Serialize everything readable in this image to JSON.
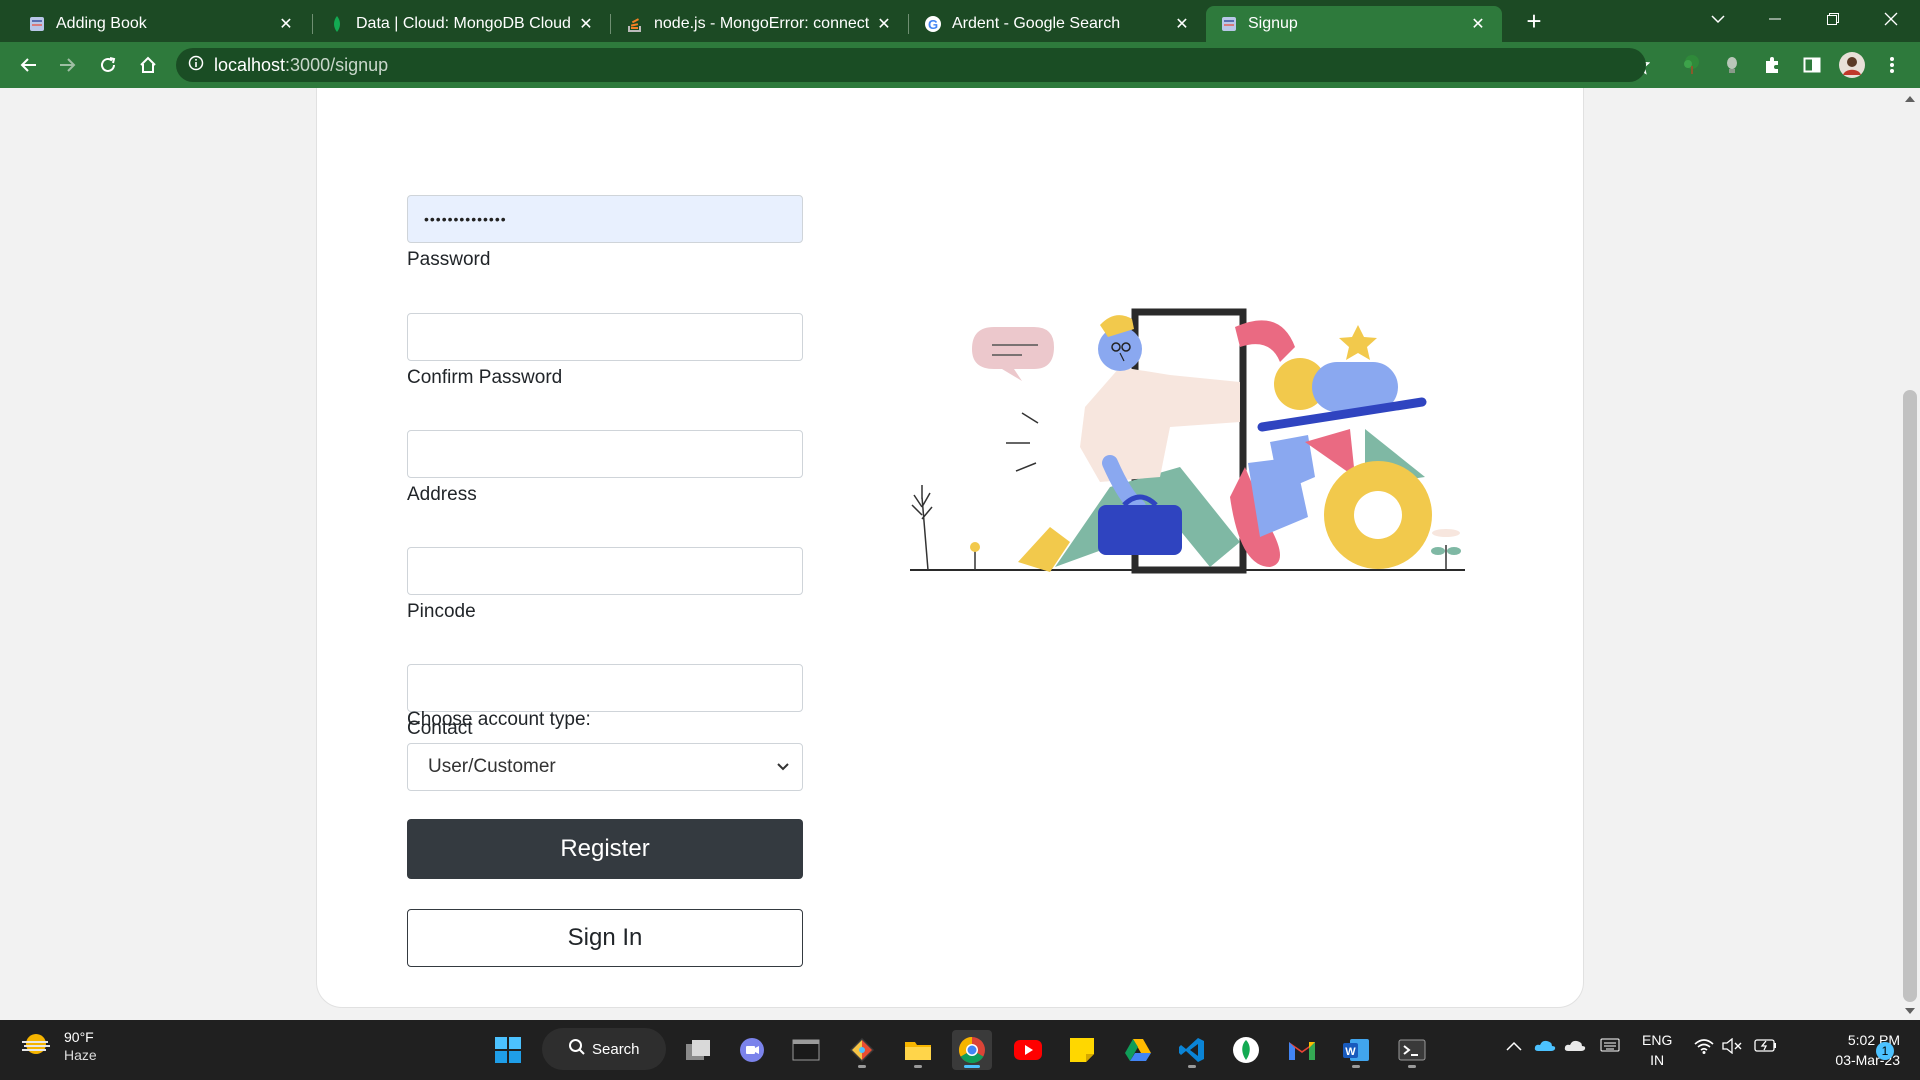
{
  "browser": {
    "tabs": [
      {
        "title": "Adding Book",
        "icon": "book-favicon",
        "active": false
      },
      {
        "title": "Data | Cloud: MongoDB Cloud",
        "icon": "mongodb-leaf-favicon",
        "active": false
      },
      {
        "title": "node.js - MongoError: connect EC",
        "icon": "stackoverflow-favicon",
        "active": false
      },
      {
        "title": "Ardent - Google Search",
        "icon": "google-favicon",
        "active": false
      },
      {
        "title": "Signup",
        "icon": "book-favicon",
        "active": true
      }
    ],
    "url_host": "localhost",
    "url_path": ":3000/signup",
    "colors": {
      "tabstrip": "#1c4a24",
      "toolbar": "#2e7a3c"
    }
  },
  "form": {
    "password_value": "••••••••••••••",
    "password_label": "Password",
    "confirm_password_label": "Confirm Password",
    "address_label": "Address",
    "pincode_label": "Pincode",
    "contact_label": "Contact",
    "account_type_label": "Choose account type:",
    "account_type_selected": "User/Customer",
    "register_label": "Register",
    "signin_label": "Sign In"
  },
  "taskbar": {
    "weather_temp": "90°F",
    "weather_desc": "Haze",
    "search_label": "Search",
    "lang_line1": "ENG",
    "lang_line2": "IN",
    "time": "5:02 PM",
    "date": "03-Mar-23",
    "notification_count": "1",
    "pinned": [
      "windows-start",
      "search",
      "task-view",
      "teams-chat",
      "terminal-app",
      "git-app",
      "file-explorer",
      "chrome",
      "youtube",
      "sticky-notes",
      "google-drive",
      "vscode",
      "mongodb-compass",
      "gmail",
      "word",
      "powershell"
    ]
  }
}
